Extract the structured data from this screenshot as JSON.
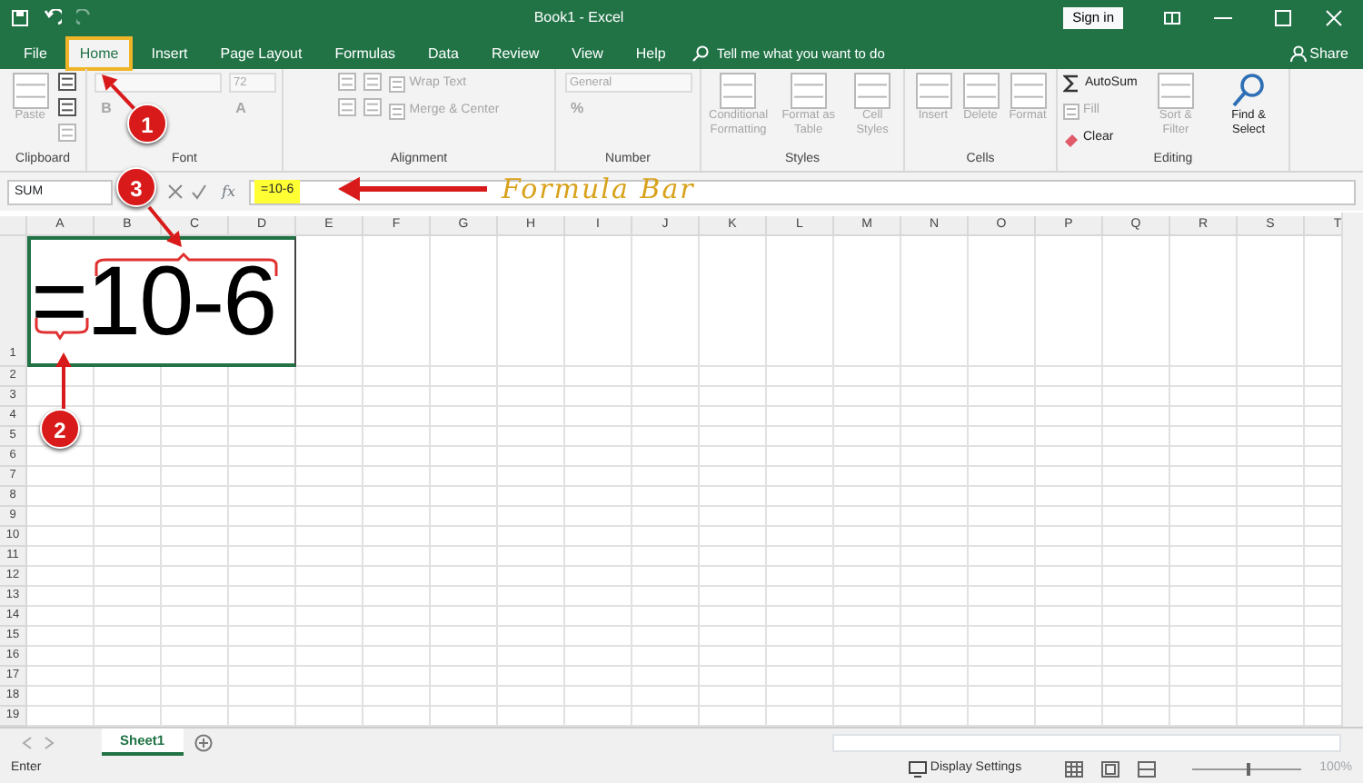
{
  "window": {
    "title": "Book1  -  Excel",
    "sign_in": "Sign in"
  },
  "tabs": [
    {
      "label": "File",
      "selected": false,
      "highlighted": false
    },
    {
      "label": "Home",
      "selected": true,
      "highlighted": true
    },
    {
      "label": "Insert",
      "selected": false,
      "highlighted": false
    },
    {
      "label": "Page Layout",
      "selected": false,
      "highlighted": false
    },
    {
      "label": "Formulas",
      "selected": false,
      "highlighted": false
    },
    {
      "label": "Data",
      "selected": false,
      "highlighted": false
    },
    {
      "label": "Review",
      "selected": false,
      "highlighted": false
    },
    {
      "label": "View",
      "selected": false,
      "highlighted": false
    },
    {
      "label": "Help",
      "selected": false,
      "highlighted": false
    }
  ],
  "tell_me": {
    "placeholder": "Tell me what you want to do"
  },
  "share": "Share",
  "ribbon": {
    "groups": [
      {
        "label": "Clipboard",
        "columns": [
          [
            {
              "kind": "large",
              "label": "Paste",
              "disabled": true
            }
          ],
          [
            {
              "kind": "icon",
              "disabled": false
            },
            {
              "kind": "icon",
              "disabled": false
            },
            {
              "kind": "icon",
              "disabled": true
            }
          ]
        ]
      },
      {
        "label": "Font",
        "columns": [
          [
            {
              "kind": "combo",
              "disabled": true
            },
            {
              "kind": "bold",
              "label": "B",
              "disabled": true
            }
          ],
          [
            {
              "kind": "field",
              "value": "72",
              "disabled": true
            },
            {
              "kind": "color",
              "label": "A",
              "disabled": true
            }
          ]
        ]
      },
      {
        "label": "Alignment",
        "columns": [
          [
            {
              "kind": "icon",
              "disabled": true
            },
            {
              "kind": "icon",
              "disabled": true
            }
          ],
          [
            {
              "kind": "icon",
              "disabled": true
            },
            {
              "kind": "icon",
              "disabled": true
            }
          ],
          [
            {
              "kind": "small",
              "label": "Wrap Text",
              "disabled": true
            },
            {
              "kind": "small",
              "label": "Merge & Center",
              "disabled": true
            }
          ]
        ]
      },
      {
        "label": "Number",
        "columns": [
          [
            {
              "kind": "combo",
              "value": "General",
              "disabled": true
            },
            {
              "kind": "percent",
              "label": "%",
              "disabled": true
            }
          ]
        ]
      },
      {
        "label": "Styles",
        "columns": [
          [
            {
              "kind": "large",
              "label": "Conditional Formatting",
              "disabled": true
            }
          ],
          [
            {
              "kind": "large",
              "label": "Format as Table",
              "disabled": true
            }
          ],
          [
            {
              "kind": "large",
              "label": "Cell Styles",
              "disabled": true
            }
          ]
        ]
      },
      {
        "label": "Cells",
        "columns": [
          [
            {
              "kind": "large",
              "label": "Insert",
              "disabled": true
            }
          ],
          [
            {
              "kind": "large",
              "label": "Delete",
              "disabled": true
            }
          ],
          [
            {
              "kind": "large",
              "label": "Format",
              "disabled": true
            }
          ]
        ]
      },
      {
        "label": "Editing",
        "columns": [
          [
            {
              "kind": "sum",
              "label": "AutoSum",
              "disabled": false
            },
            {
              "kind": "fill",
              "label": "Fill",
              "disabled": true
            },
            {
              "kind": "clear",
              "label": "Clear",
              "disabled": false
            }
          ],
          [
            {
              "kind": "large",
              "label": "Sort & Filter",
              "disabled": true
            }
          ],
          [
            {
              "kind": "find",
              "label": "Find & Select",
              "disabled": false
            }
          ]
        ]
      }
    ]
  },
  "formula_bar": {
    "name_box": "SUM",
    "fx": "fx",
    "formula": "=10-6",
    "highlighted": true
  },
  "columns": [
    "A",
    "B",
    "C",
    "D",
    "E",
    "F",
    "G",
    "H",
    "I",
    "J",
    "K",
    "L",
    "M",
    "N",
    "O",
    "P",
    "Q",
    "R",
    "S",
    "T"
  ],
  "rows": [
    "1",
    "2",
    "3",
    "4",
    "5",
    "6",
    "7",
    "8",
    "9",
    "10",
    "11",
    "12",
    "13",
    "14",
    "15",
    "16",
    "17",
    "18",
    "19"
  ],
  "cell_a1": "=10-6",
  "sheet_tabs": [
    {
      "label": "Sheet1",
      "selected": true
    }
  ],
  "status_bar": {
    "mode": "Enter",
    "display_settings": "Display Settings",
    "zoom": "100%",
    "zoom_slider": {
      "level": 0.5
    }
  },
  "annotations": {
    "callouts": [
      "1",
      "2",
      "3"
    ],
    "formula_bar_label": "Formula Bar"
  }
}
